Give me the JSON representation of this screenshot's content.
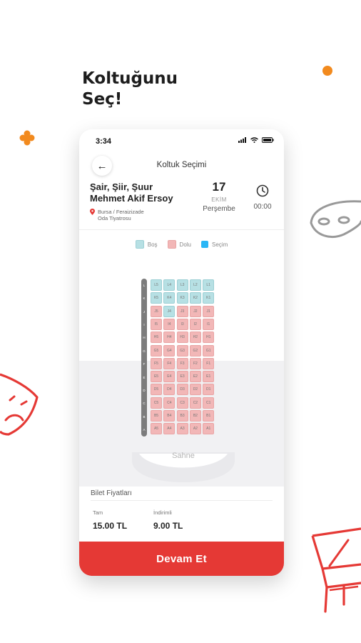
{
  "promo": {
    "headline_line1": "Koltuğunu",
    "headline_line2": "Seç!"
  },
  "status_bar": {
    "time": "3:34"
  },
  "header": {
    "title": "Koltuk Seçimi"
  },
  "event": {
    "title_line1": "Şair, Şiir, Şuur",
    "title_line2": "Mehmet Akif Ersoy",
    "venue_line1": "Bursa / Feraizizade",
    "venue_line2": "Oda Tiyatrosu",
    "day": "17",
    "month": "EKİM",
    "weekday": "Perşembe",
    "time": "00:00"
  },
  "legend": [
    {
      "label": "Boş",
      "color": "#b7e0e4"
    },
    {
      "label": "Dolu",
      "color": "#f2b7b7"
    },
    {
      "label": "Seçim",
      "color": "#29b6f6"
    }
  ],
  "seat_map": {
    "row_labels": [
      "L",
      "K",
      "J",
      "I",
      "H",
      "G",
      "F",
      "E",
      "D",
      "C",
      "B",
      "A"
    ],
    "rows": [
      {
        "row": "L",
        "seats": [
          {
            "id": "L5",
            "status": "bos"
          },
          {
            "id": "L4",
            "status": "bos"
          },
          {
            "id": "L3",
            "status": "bos"
          },
          {
            "id": "L2",
            "status": "bos"
          },
          {
            "id": "L1",
            "status": "bos"
          }
        ]
      },
      {
        "row": "K",
        "seats": [
          {
            "id": "K5",
            "status": "bos"
          },
          {
            "id": "K4",
            "status": "bos"
          },
          {
            "id": "K3",
            "status": "bos"
          },
          {
            "id": "K2",
            "status": "bos"
          },
          {
            "id": "K1",
            "status": "bos"
          }
        ]
      },
      {
        "row": "J",
        "seats": [
          {
            "id": "J5",
            "status": "dolu"
          },
          {
            "id": "J4",
            "status": "bos"
          },
          {
            "id": "J3",
            "status": "dolu"
          },
          {
            "id": "J2",
            "status": "dolu"
          },
          {
            "id": "J1",
            "status": "dolu"
          }
        ]
      },
      {
        "row": "I",
        "seats": [
          {
            "id": "I5",
            "status": "dolu"
          },
          {
            "id": "I4",
            "status": "dolu"
          },
          {
            "id": "I3",
            "status": "dolu"
          },
          {
            "id": "I2",
            "status": "dolu"
          },
          {
            "id": "I1",
            "status": "dolu"
          }
        ]
      },
      {
        "row": "H",
        "seats": [
          {
            "id": "H5",
            "status": "dolu"
          },
          {
            "id": "H4",
            "status": "dolu"
          },
          {
            "id": "H3",
            "status": "dolu"
          },
          {
            "id": "H2",
            "status": "dolu"
          },
          {
            "id": "H1",
            "status": "dolu"
          }
        ]
      },
      {
        "row": "G",
        "seats": [
          {
            "id": "G5",
            "status": "dolu"
          },
          {
            "id": "G4",
            "status": "dolu"
          },
          {
            "id": "G3",
            "status": "dolu"
          },
          {
            "id": "G2",
            "status": "dolu"
          },
          {
            "id": "G1",
            "status": "dolu"
          }
        ]
      },
      {
        "row": "F",
        "seats": [
          {
            "id": "F5",
            "status": "dolu"
          },
          {
            "id": "F4",
            "status": "dolu"
          },
          {
            "id": "F3",
            "status": "dolu"
          },
          {
            "id": "F2",
            "status": "dolu"
          },
          {
            "id": "F1",
            "status": "dolu"
          }
        ]
      },
      {
        "row": "E",
        "seats": [
          {
            "id": "E5",
            "status": "dolu"
          },
          {
            "id": "E4",
            "status": "dolu"
          },
          {
            "id": "E3",
            "status": "dolu"
          },
          {
            "id": "E2",
            "status": "dolu"
          },
          {
            "id": "E1",
            "status": "dolu"
          }
        ]
      },
      {
        "row": "D",
        "seats": [
          {
            "id": "D5",
            "status": "dolu"
          },
          {
            "id": "D4",
            "status": "dolu"
          },
          {
            "id": "D3",
            "status": "dolu"
          },
          {
            "id": "D2",
            "status": "dolu"
          },
          {
            "id": "D1",
            "status": "dolu"
          }
        ]
      },
      {
        "row": "C",
        "seats": [
          {
            "id": "C5",
            "status": "dolu"
          },
          {
            "id": "C4",
            "status": "dolu"
          },
          {
            "id": "C3",
            "status": "dolu"
          },
          {
            "id": "C2",
            "status": "dolu"
          },
          {
            "id": "C1",
            "status": "dolu"
          }
        ]
      },
      {
        "row": "B",
        "seats": [
          {
            "id": "B5",
            "status": "dolu"
          },
          {
            "id": "B4",
            "status": "dolu"
          },
          {
            "id": "B3",
            "status": "dolu"
          },
          {
            "id": "B2",
            "status": "dolu"
          },
          {
            "id": "B1",
            "status": "dolu"
          }
        ]
      },
      {
        "row": "A",
        "seats": [
          {
            "id": "A5",
            "status": "dolu"
          },
          {
            "id": "A4",
            "status": "dolu"
          },
          {
            "id": "A3",
            "status": "dolu"
          },
          {
            "id": "A2",
            "status": "dolu"
          },
          {
            "id": "A1",
            "status": "dolu"
          }
        ]
      }
    ],
    "stage_label": "Sahne"
  },
  "prices": {
    "title": "Bilet Fiyatları",
    "items": [
      {
        "label": "Tam",
        "value": "15.00 TL"
      },
      {
        "label": "İndirimli",
        "value": "9.00 TL"
      }
    ]
  },
  "actions": {
    "continue_label": "Devam Et"
  },
  "colors": {
    "accent": "#e53935",
    "orange": "#f28a1e",
    "seat_free": "#b7e0e4",
    "seat_taken": "#f2b7b7",
    "seat_selected": "#29b6f6"
  },
  "icons": [
    "flower-icon",
    "theatre-mask-icon",
    "drama-mask-icon",
    "piano-icon",
    "back-arrow-icon",
    "clock-icon",
    "location-pin-icon",
    "wifi-icon",
    "battery-icon"
  ]
}
